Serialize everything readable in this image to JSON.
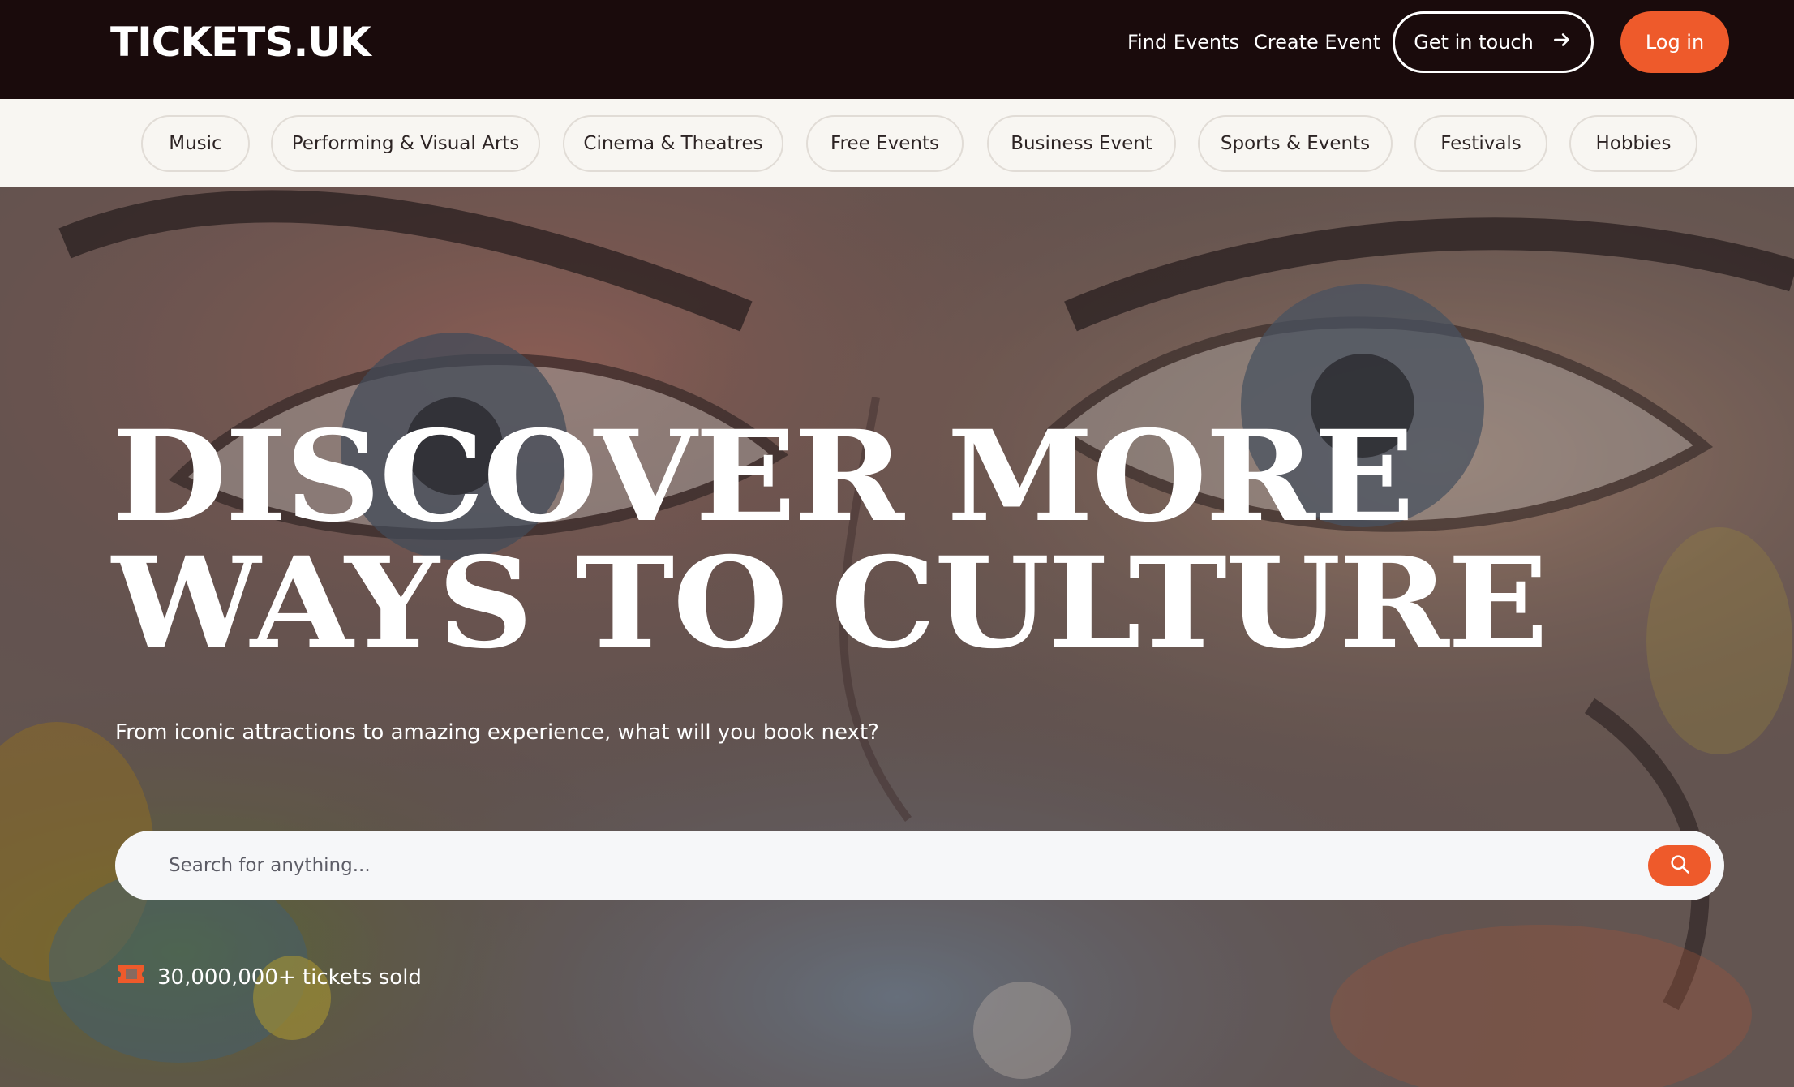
{
  "header": {
    "logo": "TICKETS.UK",
    "nav": {
      "find_events": "Find Events",
      "create_event": "Create Event",
      "get_in_touch": "Get in touch",
      "login": "Log in"
    }
  },
  "categories": [
    "Music",
    "Performing & Visual Arts",
    "Cinema & Theatres",
    "Free Events",
    "Business Event",
    "Sports & Events",
    "Festivals",
    "Hobbies"
  ],
  "hero": {
    "headline_line1": "DISCOVER MORE",
    "headline_line2": "WAYS TO CULTURE",
    "subhead": "From iconic attractions to amazing experience, what will you book next?",
    "search_placeholder": "Search for anything...",
    "stat": "30,000,000+ tickets sold"
  },
  "colors": {
    "nav_bg": "#1a0b0c",
    "accent": "#ee5a2b",
    "category_bg": "#f8f6f2"
  },
  "icons": {
    "arrow": "arrow-right-icon",
    "search": "search-icon",
    "ticket": "ticket-icon"
  }
}
